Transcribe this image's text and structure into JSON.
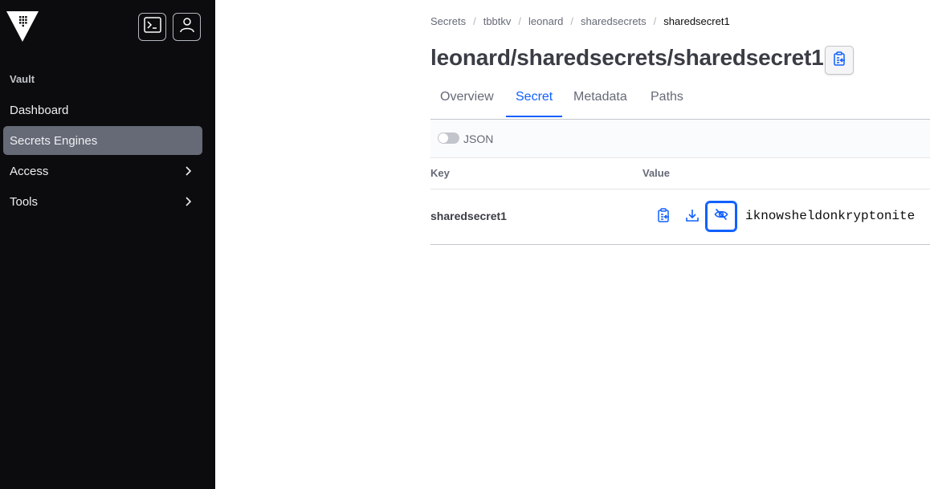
{
  "sidebar": {
    "section_title": "Vault",
    "items": [
      {
        "label": "Dashboard"
      },
      {
        "label": "Secrets Engines"
      },
      {
        "label": "Access"
      },
      {
        "label": "Tools"
      }
    ]
  },
  "breadcrumb": [
    "Secrets",
    "tbbtkv",
    "leonard",
    "sharedsecrets",
    "sharedsecret1"
  ],
  "page": {
    "title": "leonard/sharedsecrets/sharedsecret1"
  },
  "tabs": [
    "Overview",
    "Secret",
    "Metadata",
    "Paths"
  ],
  "toolbar": {
    "json_toggle_label": "JSON"
  },
  "table": {
    "headers": {
      "key": "Key",
      "value": "Value"
    },
    "rows": [
      {
        "key": "sharedsecret1",
        "value": "iknowsheldonkryptonite"
      }
    ]
  },
  "colors": {
    "sidebar_bg": "#0c0c0e",
    "active_nav": "#656a76",
    "accent": "#1060ff"
  },
  "icons": [
    "vault-logo-icon",
    "terminal-icon",
    "user-icon",
    "chevron-right-icon",
    "clipboard-copy-icon",
    "download-icon",
    "eye-off-icon"
  ]
}
